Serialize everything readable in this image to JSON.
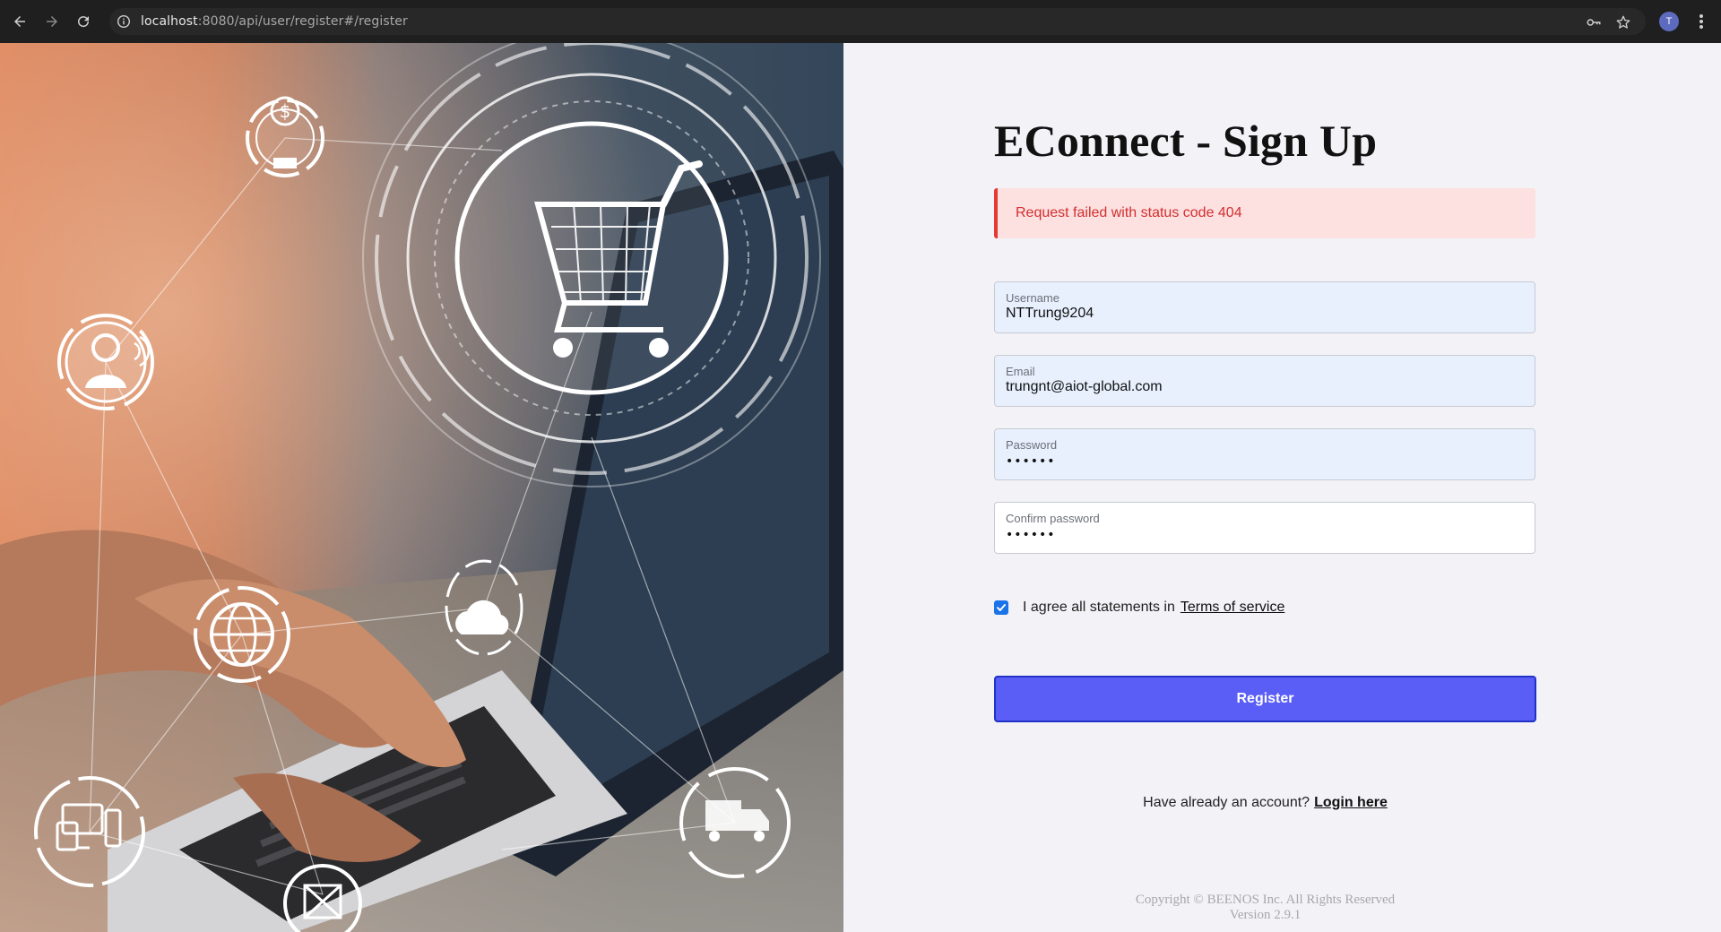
{
  "browser": {
    "url_host": "localhost",
    "url_rest": ":8080/api/user/register#/register",
    "avatar_initial": "T",
    "icons": [
      "back-arrow-icon",
      "forward-arrow-icon",
      "reload-icon",
      "info-icon",
      "key-icon",
      "star-icon",
      "more-menu-icon"
    ]
  },
  "hero": {
    "icons": [
      "dollar-coin-icon",
      "shopping-cart-icon",
      "customer-support-icon",
      "globe-icon",
      "cloud-icon",
      "devices-icon",
      "mail-icon",
      "delivery-truck-icon"
    ]
  },
  "form": {
    "title": "EConnect - Sign Up",
    "alert": "Request failed with status code 404",
    "fields": {
      "username": {
        "label": "Username",
        "value": "NTTrung9204"
      },
      "email": {
        "label": "Email",
        "value": "trungnt@aiot-global.com"
      },
      "password": {
        "label": "Password",
        "value": "••••••"
      },
      "confirm": {
        "label": "Confirm password",
        "value": "••••••"
      }
    },
    "agree_text": "I agree all statements in",
    "terms_link": "Terms of service",
    "agree_checked": true,
    "register_label": "Register",
    "login_prompt": "Have already an account?",
    "login_link": "Login here",
    "copyright": "Copyright © BEENOS Inc. All Rights Reserved",
    "version": "Version 2.9.1"
  },
  "colors": {
    "accent": "#5a5ef7",
    "alert_bg": "#fde0e0",
    "alert_text": "#d32f2f",
    "filled_field": "#e8f0fe"
  }
}
